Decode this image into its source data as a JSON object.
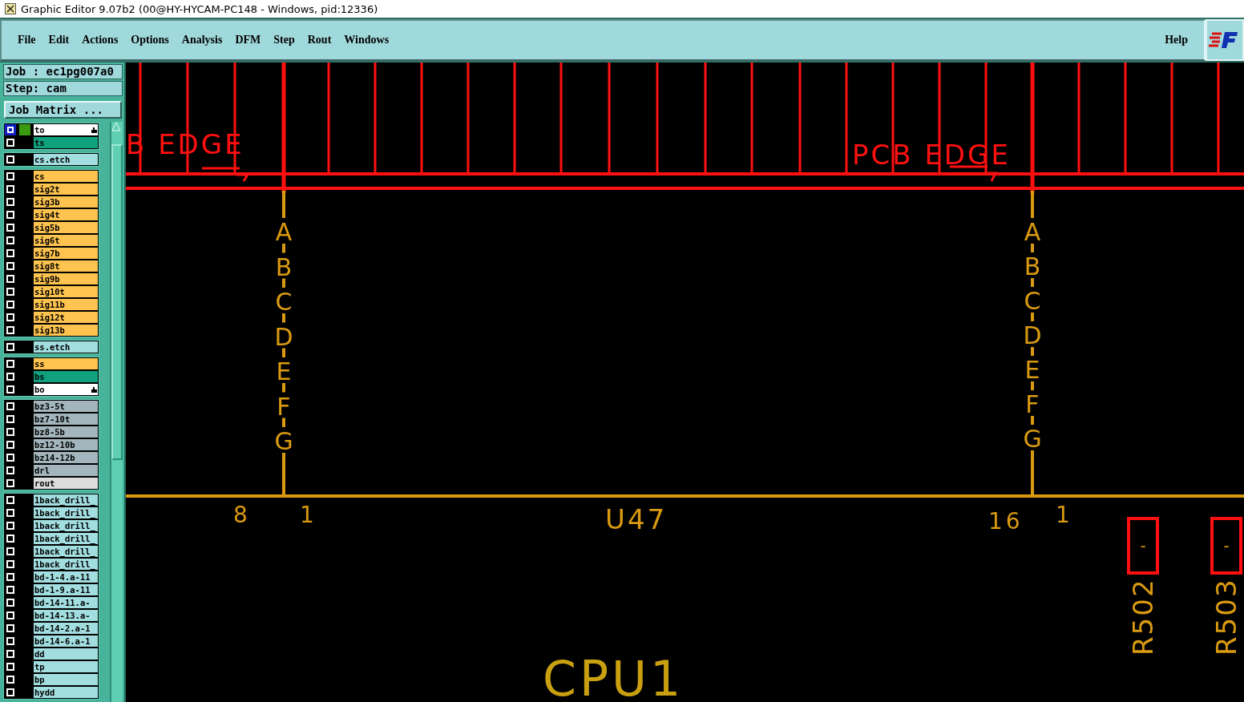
{
  "window": {
    "title": "Graphic Editor 9.07b2 (00@HY-HYCAM-PC148 - Windows, pid:12336)"
  },
  "menu": [
    {
      "label": "File"
    },
    {
      "label": "Edit"
    },
    {
      "label": "Actions"
    },
    {
      "label": "Options"
    },
    {
      "label": "Analysis"
    },
    {
      "label": "DFM"
    },
    {
      "label": "Step"
    },
    {
      "label": "Rout"
    },
    {
      "label": "Windows"
    }
  ],
  "help_menu": "Help",
  "job": {
    "job_label": "Job : ec1pg007a0",
    "step_label": "Step: cam",
    "matrix_button": "Job Matrix ..."
  },
  "layer_groups": [
    {
      "layers": [
        {
          "name": "to",
          "color": "#ffffff",
          "selected": true,
          "work_layer": true,
          "locked": true
        },
        {
          "name": "ts",
          "color": "#10a27e",
          "selected": false,
          "work_layer": false,
          "locked": false
        }
      ]
    },
    {
      "layers": [
        {
          "name": "cs.etch",
          "color": "#a2dde0",
          "selected": false,
          "work_layer": false,
          "locked": false
        }
      ]
    },
    {
      "layers": [
        {
          "name": "cs",
          "color": "#ffc44f",
          "selected": false,
          "work_layer": false,
          "locked": false
        },
        {
          "name": "sig2t",
          "color": "#ffc44f",
          "selected": false,
          "work_layer": false,
          "locked": false
        },
        {
          "name": "sig3b",
          "color": "#ffc44f",
          "selected": false,
          "work_layer": false,
          "locked": false
        },
        {
          "name": "sig4t",
          "color": "#ffc44f",
          "selected": false,
          "work_layer": false,
          "locked": false
        },
        {
          "name": "sig5b",
          "color": "#ffc44f",
          "selected": false,
          "work_layer": false,
          "locked": false
        },
        {
          "name": "sig6t",
          "color": "#ffc44f",
          "selected": false,
          "work_layer": false,
          "locked": false
        },
        {
          "name": "sig7b",
          "color": "#ffc44f",
          "selected": false,
          "work_layer": false,
          "locked": false
        },
        {
          "name": "sig8t",
          "color": "#ffc44f",
          "selected": false,
          "work_layer": false,
          "locked": false
        },
        {
          "name": "sig9b",
          "color": "#ffc44f",
          "selected": false,
          "work_layer": false,
          "locked": false
        },
        {
          "name": "sig10t",
          "color": "#ffc44f",
          "selected": false,
          "work_layer": false,
          "locked": false
        },
        {
          "name": "sig11b",
          "color": "#ffc44f",
          "selected": false,
          "work_layer": false,
          "locked": false
        },
        {
          "name": "sig12t",
          "color": "#ffc44f",
          "selected": false,
          "work_layer": false,
          "locked": false
        },
        {
          "name": "sig13b",
          "color": "#ffc44f",
          "selected": false,
          "work_layer": false,
          "locked": false
        }
      ]
    },
    {
      "layers": [
        {
          "name": "ss.etch",
          "color": "#a2dde0",
          "selected": false,
          "work_layer": false,
          "locked": false
        }
      ]
    },
    {
      "layers": [
        {
          "name": "ss",
          "color": "#ffc44f",
          "selected": false,
          "work_layer": false,
          "locked": false
        },
        {
          "name": "bs",
          "color": "#10a27e",
          "selected": false,
          "work_layer": false,
          "locked": false
        },
        {
          "name": "bo",
          "color": "#ffffff",
          "selected": false,
          "work_layer": false,
          "locked": true
        }
      ]
    },
    {
      "layers": [
        {
          "name": "bz3-5t",
          "color": "#a3b6bd",
          "selected": false,
          "work_layer": false,
          "locked": false
        },
        {
          "name": "bz7-10t",
          "color": "#a3b6bd",
          "selected": false,
          "work_layer": false,
          "locked": false
        },
        {
          "name": "bz8-5b",
          "color": "#a3b6bd",
          "selected": false,
          "work_layer": false,
          "locked": false
        },
        {
          "name": "bz12-10b",
          "color": "#a3b6bd",
          "selected": false,
          "work_layer": false,
          "locked": false
        },
        {
          "name": "bz14-12b",
          "color": "#a3b6bd",
          "selected": false,
          "work_layer": false,
          "locked": false
        },
        {
          "name": "drl",
          "color": "#a3b6bd",
          "selected": false,
          "work_layer": false,
          "locked": false
        },
        {
          "name": "rout",
          "color": "#dcdcdc",
          "selected": false,
          "work_layer": false,
          "locked": false
        }
      ]
    },
    {
      "layers": [
        {
          "name": "1back_drill_",
          "color": "#a2dde0",
          "selected": false,
          "work_layer": false,
          "locked": false
        },
        {
          "name": "1back_drill_",
          "color": "#a2dde0",
          "selected": false,
          "work_layer": false,
          "locked": false
        },
        {
          "name": "1back_drill_",
          "color": "#a2dde0",
          "selected": false,
          "work_layer": false,
          "locked": false
        },
        {
          "name": "1back_drill_",
          "color": "#a2dde0",
          "selected": false,
          "work_layer": false,
          "locked": false
        },
        {
          "name": "1back_drill_",
          "color": "#a2dde0",
          "selected": false,
          "work_layer": false,
          "locked": false
        },
        {
          "name": "1back_drill_",
          "color": "#a2dde0",
          "selected": false,
          "work_layer": false,
          "locked": false
        },
        {
          "name": "bd-1-4.a-11",
          "color": "#a2dde0",
          "selected": false,
          "work_layer": false,
          "locked": false
        },
        {
          "name": "bd-1-9.a-11",
          "color": "#a2dde0",
          "selected": false,
          "work_layer": false,
          "locked": false
        },
        {
          "name": "bd-14-11.a-",
          "color": "#a2dde0",
          "selected": false,
          "work_layer": false,
          "locked": false
        },
        {
          "name": "bd-14-13.a-",
          "color": "#a2dde0",
          "selected": false,
          "work_layer": false,
          "locked": false
        },
        {
          "name": "bd-14-2.a-1",
          "color": "#a2dde0",
          "selected": false,
          "work_layer": false,
          "locked": false
        },
        {
          "name": "bd-14-6.a-1",
          "color": "#a2dde0",
          "selected": false,
          "work_layer": false,
          "locked": false
        },
        {
          "name": "dd",
          "color": "#a2dde0",
          "selected": false,
          "work_layer": false,
          "locked": false
        },
        {
          "name": "tp",
          "color": "#a2dde0",
          "selected": false,
          "work_layer": false,
          "locked": false
        },
        {
          "name": "bp",
          "color": "#a2dde0",
          "selected": false,
          "work_layer": false,
          "locked": false
        },
        {
          "name": "hydd",
          "color": "#a2dde0",
          "selected": false,
          "work_layer": false,
          "locked": false
        }
      ]
    }
  ],
  "canvas": {
    "edge_labels": [
      "B EDGE",
      "PCB EDGE"
    ],
    "pin_columns": [
      [
        "A",
        "B",
        "C",
        "D",
        "E",
        "F",
        "G"
      ],
      [
        "A",
        "B",
        "C",
        "D",
        "E",
        "F",
        "G"
      ]
    ],
    "pin_numbers": [
      "8",
      "1",
      "16",
      "1"
    ],
    "component_label": "U47",
    "resistors": [
      {
        "pad": "-",
        "label": "R502"
      },
      {
        "pad": "-",
        "label": "R503"
      }
    ],
    "part_label": "CPU1"
  }
}
